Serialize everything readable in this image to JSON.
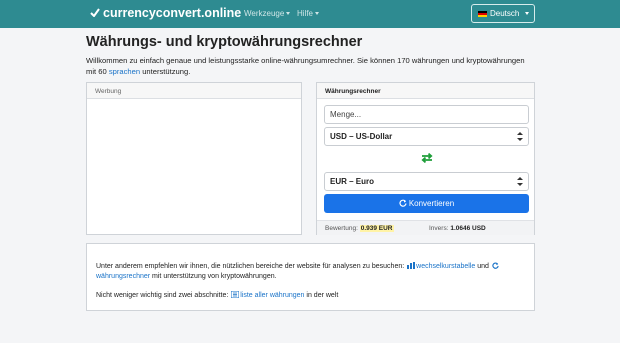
{
  "navbar": {
    "brand": "currencyconvert.online",
    "menu": [
      {
        "label": "Werkzeuge"
      },
      {
        "label": "Hilfe"
      }
    ],
    "language": "Deutsch"
  },
  "page": {
    "title": "Währungs- und kryptowährungsrechner",
    "intro_text": "Willkommen zu einfach genaue und leistungsstarke online-währungsumrechner. Sie können 170 währungen und kryptowährungen mit 60",
    "intro_link": "sprachen",
    "intro_end": "unterstützung."
  },
  "ad": {
    "header": "Werbung"
  },
  "converter": {
    "header": "Währungsrechner",
    "amount_placeholder": "Menge...",
    "from_currency": "USD – US-Dollar",
    "to_currency": "EUR – Euro",
    "convert_label": "Konvertieren",
    "rate_label": "Bewertung:",
    "rate_value": "0.939 EUR",
    "inverse_label": "Invers:",
    "inverse_value": "1.0646 USD"
  },
  "info": {
    "line1_text": "Unter anderem empfehlen wir ihnen, die nützlichen bereiche der website für analysen zu besuchen:",
    "line1_link1": "wechselkurstabelle",
    "line1_and": "und",
    "line1_link2": "währungsrechner",
    "line1_end": "mit unterstützung von kryptowährungen.",
    "line2_text": "Nicht weniger wichtig sind zwei abschnitte:",
    "line2_link": "liste aller währungen",
    "line2_end": "in der welt"
  },
  "colors": {
    "navbar": "#2e8b91",
    "primary_button": "#1a73e8",
    "link": "#1a73c8",
    "swap_icon": "#1e9e3a",
    "rate_highlight": "#fff3a6"
  }
}
